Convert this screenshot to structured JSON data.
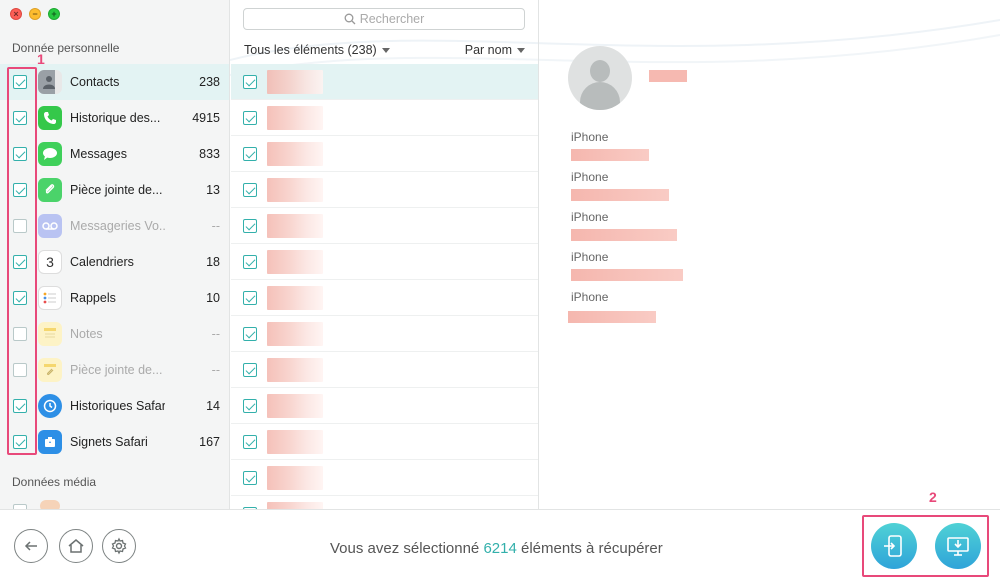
{
  "sidebar": {
    "personal_title": "Donnée personnelle",
    "media_title": "Données média",
    "categories": [
      {
        "label": "Contacts",
        "count": "238",
        "checked": true,
        "disabled": false
      },
      {
        "label": "Historique des...",
        "count": "4915",
        "checked": true,
        "disabled": false
      },
      {
        "label": "Messages",
        "count": "833",
        "checked": true,
        "disabled": false
      },
      {
        "label": "Pièce jointe de...",
        "count": "13",
        "checked": true,
        "disabled": false
      },
      {
        "label": "Messageries Vo...",
        "count": "--",
        "checked": false,
        "disabled": true
      },
      {
        "label": "Calendriers",
        "count": "18",
        "checked": true,
        "disabled": false
      },
      {
        "label": "Rappels",
        "count": "10",
        "checked": true,
        "disabled": false
      },
      {
        "label": "Notes",
        "count": "--",
        "checked": false,
        "disabled": true
      },
      {
        "label": "Pièce jointe de...",
        "count": "--",
        "checked": false,
        "disabled": true
      },
      {
        "label": "Historiques Safari",
        "count": "14",
        "checked": true,
        "disabled": false
      },
      {
        "label": "Signets Safari",
        "count": "167",
        "checked": true,
        "disabled": false
      }
    ],
    "calendar_day": "3"
  },
  "list": {
    "search_placeholder": "Rechercher",
    "all_items_label": "Tous les éléments (238)",
    "sort_label": "Par nom"
  },
  "detail": {
    "fields": [
      "iPhone",
      "iPhone",
      "iPhone",
      "iPhone",
      "iPhone"
    ]
  },
  "annotations": {
    "marker1": "1",
    "marker2": "2"
  },
  "bottom": {
    "status_prefix": "Vous avez sélectionné",
    "status_count": "6214",
    "status_suffix": "éléments à récupérer"
  },
  "colors": {
    "accent": "#33b0ab",
    "annotation": "#e8497a",
    "action_button": "#3cb8d8"
  }
}
